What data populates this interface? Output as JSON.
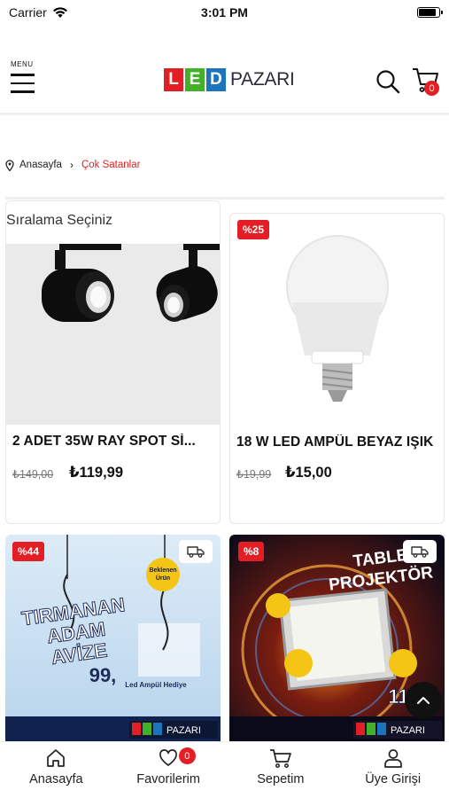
{
  "status_bar": {
    "carrier": "Carrier",
    "time": "3:01 PM"
  },
  "header": {
    "menu_label": "MENU",
    "logo_letters": [
      "L",
      "E",
      "D"
    ],
    "logo_word": "PAZARI",
    "logo_colors": [
      "#e31e24",
      "#43b02a",
      "#1c75bc"
    ],
    "cart_count": "0"
  },
  "breadcrumb": {
    "home": "Anasayfa",
    "current": "Çok Satanlar"
  },
  "sort": {
    "label": "Sıralama Seçiniz"
  },
  "products": [
    {
      "name": "2 ADET 35W RAY SPOT Sİ...",
      "old_price": "₺149,00",
      "price": "₺119,99",
      "badge": ""
    },
    {
      "name": "18 W LED AMPÜL BEYAZ IŞIK",
      "old_price": "₺19,99",
      "price": "₺15,00",
      "badge": "%25"
    },
    {
      "name": "",
      "badge": "%44",
      "banner": {
        "title1": "TIRMANAN",
        "title2": "ADAM",
        "title3": "AVİZE",
        "price": "99,",
        "sticker": "Beklenen Ürün",
        "gift": "Led Ampül Hediye",
        "footer_logo": "LED PAZARI"
      }
    },
    {
      "name": "",
      "badge": "%8",
      "banner": {
        "title1": "TABLET",
        "title2": "PROJEKTÖR",
        "price": "119,",
        "footer_logo": "LED PAZARI"
      }
    }
  ],
  "tabbar": {
    "items": [
      {
        "label": "Anasayfa",
        "icon": "home-icon"
      },
      {
        "label": "Favorilerim",
        "icon": "heart-icon",
        "badge": "0"
      },
      {
        "label": "Sepetim",
        "icon": "cart-icon"
      },
      {
        "label": "Üye Girişi",
        "icon": "user-icon"
      }
    ]
  },
  "colors": {
    "accent": "#e31e24",
    "text": "#111111"
  }
}
